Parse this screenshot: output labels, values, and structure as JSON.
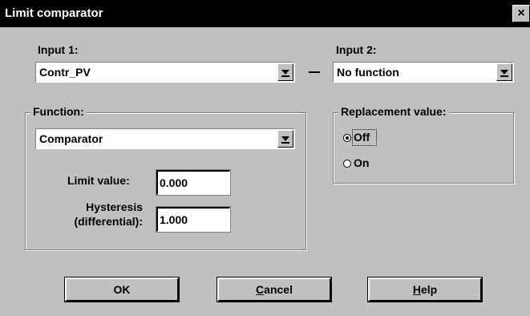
{
  "window": {
    "title": "Limit comparator",
    "close_label": "×"
  },
  "input1": {
    "label": "Input 1:",
    "value": "Contr_PV"
  },
  "operator": "-",
  "input2": {
    "label": "Input 2:",
    "value": "No function"
  },
  "function_group": {
    "title": "Function:",
    "value": "Comparator",
    "limit_label": "Limit value:",
    "limit_value": "0.000",
    "hysteresis_label_1": "Hysteresis",
    "hysteresis_label_2": "(differential):",
    "hysteresis_value": "1.000"
  },
  "replacement_group": {
    "title": "Replacement value:",
    "options": [
      {
        "label": "Off",
        "checked": true
      },
      {
        "label": "On",
        "checked": false
      }
    ]
  },
  "buttons": {
    "ok": "OK",
    "cancel_mnemonic": "C",
    "cancel_rest": "ancel",
    "help_mnemonic": "H",
    "help_rest": "elp"
  }
}
